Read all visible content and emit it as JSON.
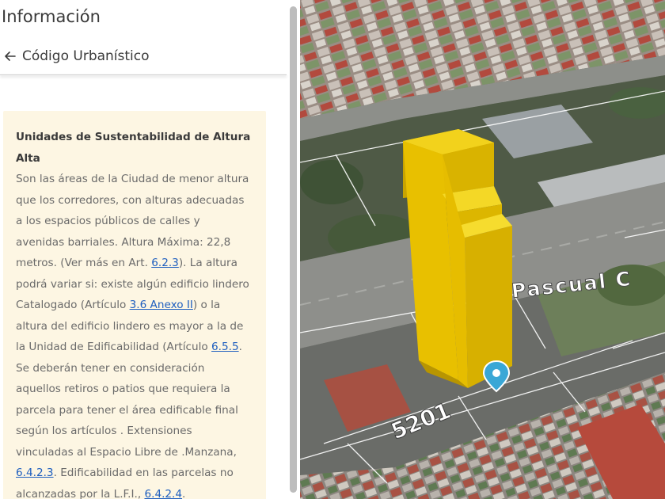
{
  "panel": {
    "title": "Información",
    "back_label": "Código Urbanístico"
  },
  "card": {
    "heading_line1": "Unidades de Sustentabilidad de Altura",
    "heading_line2": "Alta",
    "lines": [
      {
        "pre": "Son las áreas de la Ciudad de menor altura"
      },
      {
        "pre": "que los corredores, con alturas adecuadas"
      },
      {
        "pre": "a los espacios públicos de calles y"
      },
      {
        "pre": "avenidas barriales. Altura Máxima: 22,8"
      },
      {
        "pre": "metros. (Ver más en Art. ",
        "link": "6.2.3",
        "post": "). La altura"
      },
      {
        "pre": "podrá variar si: existe algún edificio lindero"
      },
      {
        "pre": "Catalogado (Artículo ",
        "link": "3.6 Anexo II",
        "post": ") o la"
      },
      {
        "pre": "altura del edificio lindero es mayor a la de"
      },
      {
        "pre": "la Unidad de Edificabilidad (Artículo ",
        "link": "6.5.5",
        "post": "."
      },
      {
        "pre": "Se deberán tener en consideración"
      },
      {
        "pre": "aquellos retiros o patios que requiera la"
      },
      {
        "pre": "parcela para tener el área edificable final"
      },
      {
        "pre": "según los artículos . Extensiones"
      },
      {
        "pre": "vinculadas al Espacio Libre de .Manzana,"
      },
      {
        "pre": "",
        "link": "6.4.2.3",
        "post": ". Edificabilidad en las parcelas no"
      },
      {
        "pre": "alcanzadas por la L.F.I., ",
        "link": "6.4.2.4",
        "post": "."
      }
    ]
  },
  "map": {
    "street_label": "Pascual C",
    "street_number": "5201",
    "marker_color": "#3aa7d6",
    "volume_color": "#e8c000"
  },
  "icons": {
    "back": "arrow-left-icon",
    "marker": "map-pin-icon"
  }
}
